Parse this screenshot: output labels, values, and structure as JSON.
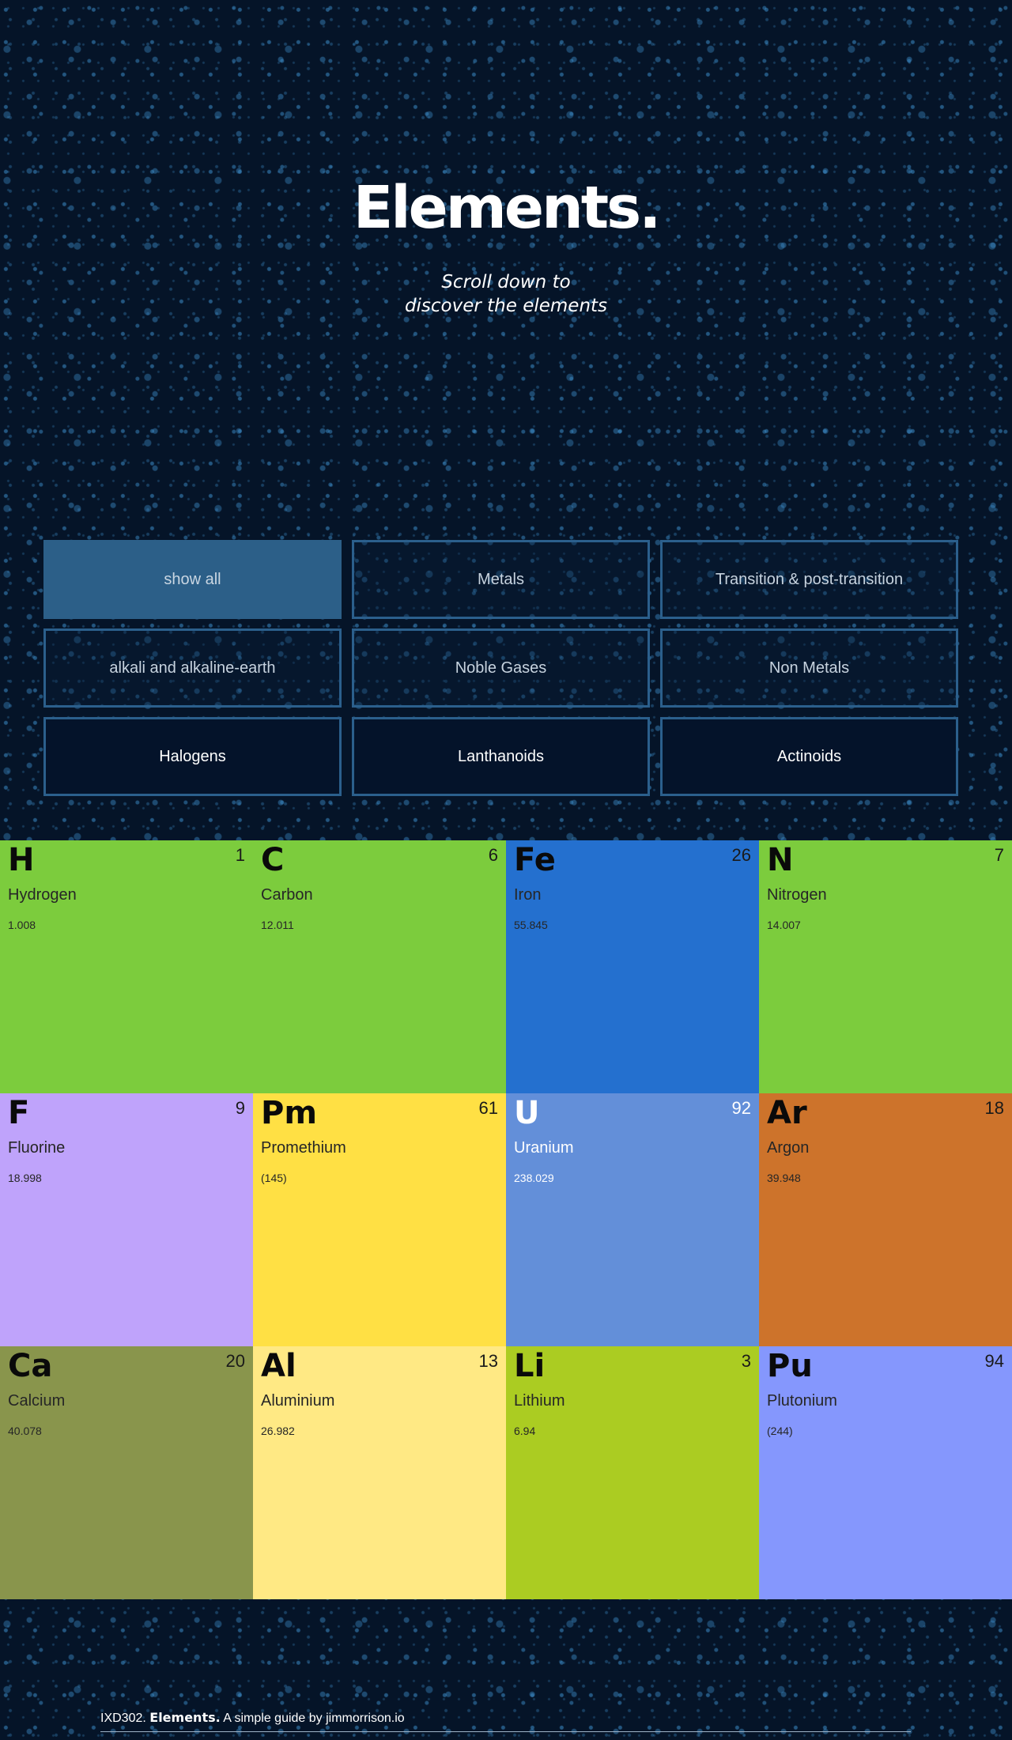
{
  "hero": {
    "title": "Elements.",
    "subtitle_line1": "Scroll down to",
    "subtitle_line2": "discover the elements"
  },
  "filters": [
    {
      "label": "show all",
      "state": "active"
    },
    {
      "label": "Metals",
      "state": "default"
    },
    {
      "label": "Transition & post-transition",
      "state": "default"
    },
    {
      "label": "alkali and alkaline-earth",
      "state": "default"
    },
    {
      "label": "Noble Gases",
      "state": "default"
    },
    {
      "label": "Non Metals",
      "state": "default"
    },
    {
      "label": "Halogens",
      "state": "solid"
    },
    {
      "label": "Lanthanoids",
      "state": "solid"
    },
    {
      "label": "Actinoids",
      "state": "solid"
    }
  ],
  "elements": [
    {
      "symbol": "H",
      "number": "1",
      "name": "Hydrogen",
      "mass": "1.008",
      "color": "#7ccc3d"
    },
    {
      "symbol": "C",
      "number": "6",
      "name": "Carbon",
      "mass": "12.011",
      "color": "#7ccc3d"
    },
    {
      "symbol": "Fe",
      "number": "26",
      "name": "Iron",
      "mass": "55.845",
      "color": "#2470cf"
    },
    {
      "symbol": "N",
      "number": "7",
      "name": "Nitrogen",
      "mass": "14.007",
      "color": "#7ccc3d"
    },
    {
      "symbol": "F",
      "number": "9",
      "name": "Fluorine",
      "mass": "18.998",
      "color": "#bfa3fb"
    },
    {
      "symbol": "Pm",
      "number": "61",
      "name": "Promethium",
      "mass": "(145)",
      "color": "#ffe044"
    },
    {
      "symbol": "U",
      "number": "92",
      "name": "Uranium",
      "mass": "238.029",
      "color": "#638fd9",
      "light": true
    },
    {
      "symbol": "Ar",
      "number": "18",
      "name": "Argon",
      "mass": "39.948",
      "color": "#cd732b"
    },
    {
      "symbol": "Ca",
      "number": "20",
      "name": "Calcium",
      "mass": "40.078",
      "color": "#89954c"
    },
    {
      "symbol": "Al",
      "number": "13",
      "name": "Aluminium",
      "mass": "26.982",
      "color": "#ffe984"
    },
    {
      "symbol": "Li",
      "number": "3",
      "name": "Lithium",
      "mass": "6.94",
      "color": "#abcc22"
    },
    {
      "symbol": "Pu",
      "number": "94",
      "name": "Plutonium",
      "mass": "(244)",
      "color": "#8597fd"
    }
  ],
  "footer": {
    "course": "IXD302.",
    "brand": "Elements.",
    "credit": "A simple guide by jimmorrison.io"
  }
}
